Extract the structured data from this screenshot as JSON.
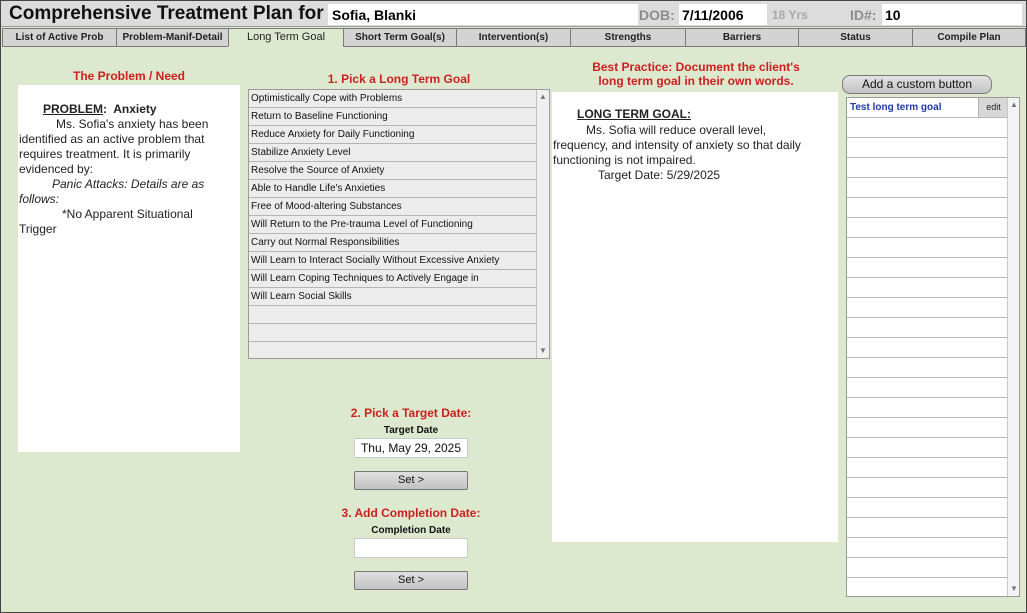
{
  "header": {
    "title": "Comprehensive Treatment Plan for",
    "client_name": "Sofia, Blanki",
    "dob_label": "DOB:",
    "dob_value": "7/11/2006",
    "age": "18 Yrs",
    "id_label": "ID#:",
    "id_value": "10"
  },
  "tabs": [
    {
      "label": "List of Active Prob"
    },
    {
      "label": "Problem-Manif-Detail"
    },
    {
      "label": "Long Term Goal"
    },
    {
      "label": "Short Term Goal(s)"
    },
    {
      "label": "Intervention(s)"
    },
    {
      "label": "Strengths"
    },
    {
      "label": "Barriers"
    },
    {
      "label": "Status"
    },
    {
      "label": "Compile Plan"
    }
  ],
  "problem": {
    "heading": "The Problem / Need",
    "label": "PROBLEM",
    "name": "Anxiety",
    "lines": [
      "Ms. Sofia's anxiety has been",
      "identified as an active problem that",
      "requires treatment. It is primarily",
      "evidenced by:",
      "Panic Attacks: Details are as",
      "follows:",
      "*No Apparent Situational",
      "Trigger"
    ]
  },
  "goal_picker": {
    "heading": "1. Pick a Long Term Goal",
    "items": [
      "Optimistically Cope with Problems",
      "Return to Baseline Functioning",
      "Reduce Anxiety for Daily Functioning",
      "Stabilize Anxiety Level",
      "Resolve the Source of Anxiety",
      "Able to Handle Life's Anxieties",
      "Free of Mood-altering Substances",
      "Will Return to the Pre-trauma Level of Functioning",
      "Carry out Normal Responsibilities",
      "Will Learn to Interact Socially Without Excessive Anxiety",
      "Will Learn Coping Techniques to Actively Engage in",
      "Will Learn Social Skills",
      "",
      "",
      ""
    ]
  },
  "target": {
    "heading": "2. Pick a Target Date:",
    "field_label": "Target Date",
    "value": "Thu, May 29, 2025",
    "set_label": "Set  >"
  },
  "completion": {
    "heading": "3. Add Completion Date:",
    "field_label": "Completion Date",
    "value": "",
    "set_label": "Set  >"
  },
  "best_practice": {
    "line1": "Best Practice: Document the client's",
    "line2": "long term goal in their own words."
  },
  "ltg": {
    "heading": "LONG TERM GOAL:",
    "line1": "Ms. Sofia will reduce overall level,",
    "line2": "frequency, and intensity of anxiety so that daily",
    "line3": "functioning is not impaired.",
    "target_line": "Target Date:  5/29/2025"
  },
  "custom": {
    "add_label": "Add a custom button",
    "first_item": "Test long term goal",
    "edit_label": "edit"
  },
  "colors": {
    "background": "#dde9cf",
    "accent_red": "#cc1f1f",
    "link_blue": "#1f3aa8"
  }
}
